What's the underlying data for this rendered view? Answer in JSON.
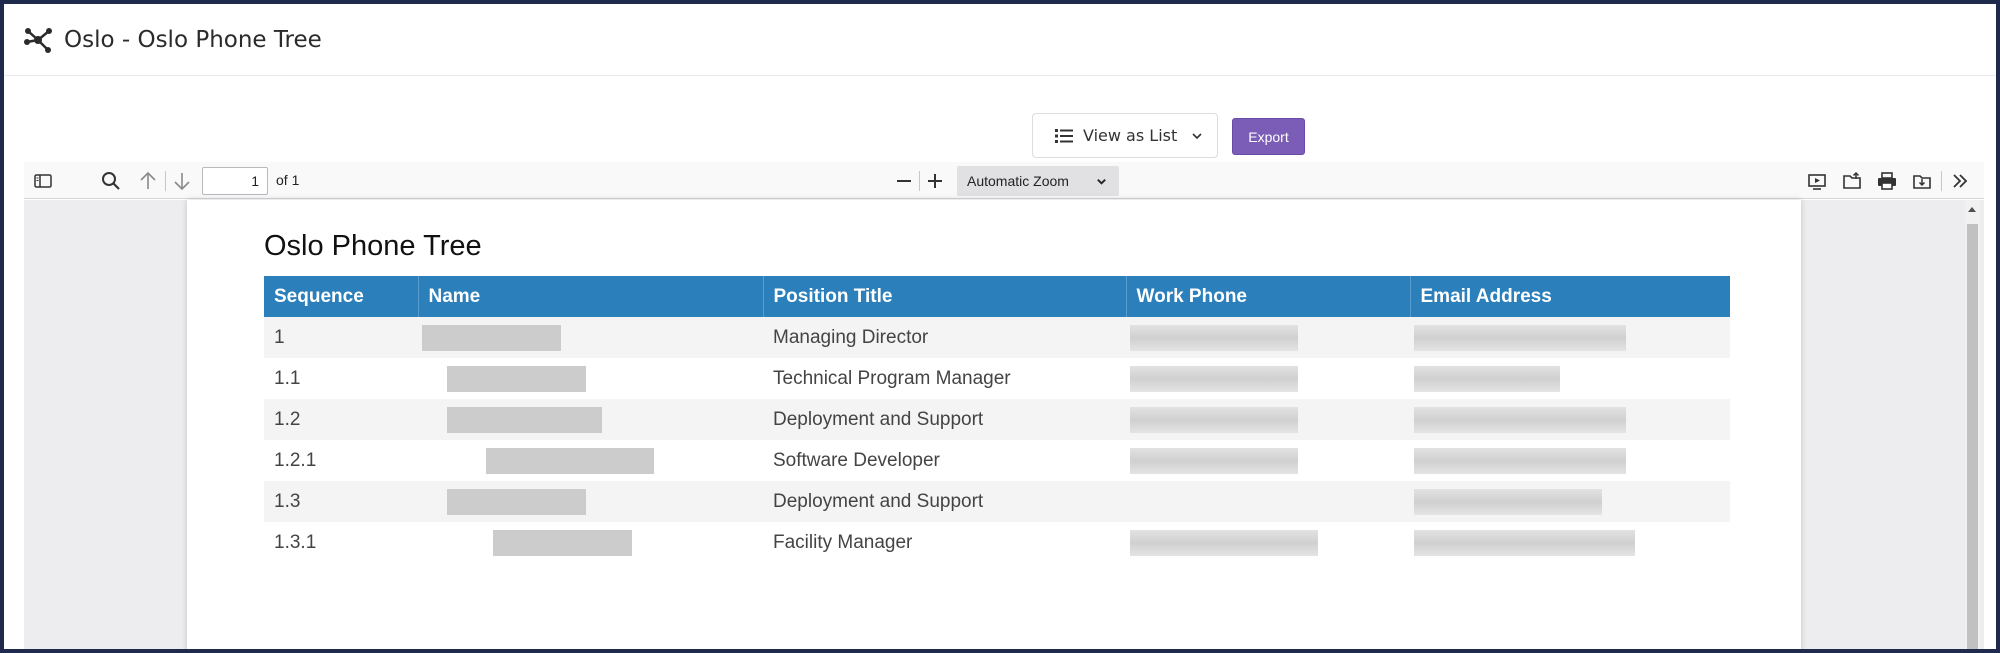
{
  "header": {
    "logo_icon": "hub-network-icon",
    "title": "Oslo - Oslo Phone Tree"
  },
  "actions": {
    "view_label": "View as List",
    "export_label": "Export"
  },
  "colors": {
    "accent": "#7b5cb7",
    "table_header": "#2b7fbb",
    "frame_border": "#1f2a4d"
  },
  "pdf_toolbar": {
    "page_number": "1",
    "page_of": "of 1",
    "zoom": "Automatic Zoom"
  },
  "document": {
    "title": "Oslo Phone Tree",
    "columns": [
      "Sequence",
      "Name",
      "Position Title",
      "Work Phone",
      "Email Address"
    ],
    "rows": [
      {
        "sequence": "1",
        "position": "Managing Director"
      },
      {
        "sequence": "1.1",
        "position": "Technical Program Manager"
      },
      {
        "sequence": "1.2",
        "position": "Deployment and Support"
      },
      {
        "sequence": "1.2.1",
        "position": "Software Developer"
      },
      {
        "sequence": "1.3",
        "position": "Deployment and Support"
      },
      {
        "sequence": "1.3.1",
        "position": "Facility Manager"
      }
    ]
  }
}
